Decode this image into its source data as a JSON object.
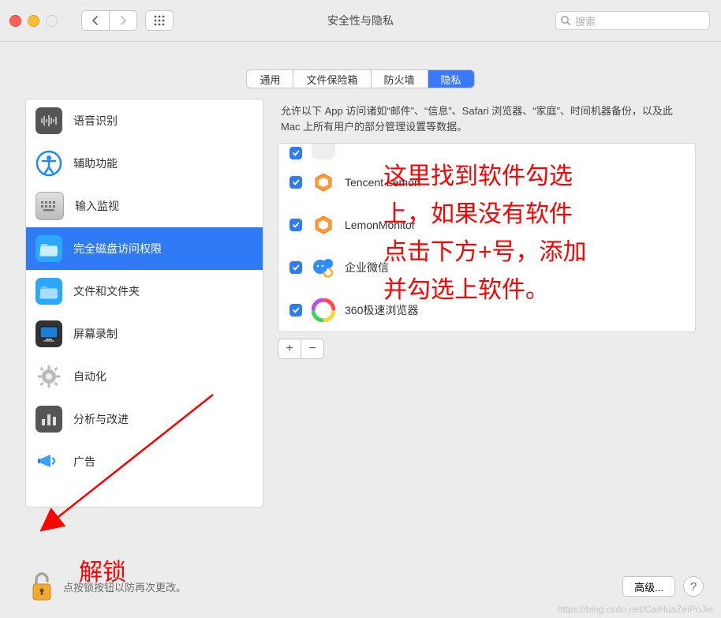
{
  "window": {
    "title": "安全性与隐私",
    "search_placeholder": "搜索"
  },
  "tabs": [
    {
      "label": "通用",
      "active": false
    },
    {
      "label": "文件保险箱",
      "active": false
    },
    {
      "label": "防火墙",
      "active": false
    },
    {
      "label": "隐私",
      "active": true
    }
  ],
  "sidebar": {
    "items": [
      {
        "icon": "waveform-icon",
        "label": "语音识别"
      },
      {
        "icon": "accessibility-icon",
        "label": "辅助功能"
      },
      {
        "icon": "keyboard-icon",
        "label": "输入监视"
      },
      {
        "icon": "folder-icon",
        "label": "完全磁盘访问权限",
        "selected": true
      },
      {
        "icon": "folder-icon",
        "label": "文件和文件夹"
      },
      {
        "icon": "monitor-icon",
        "label": "屏幕录制"
      },
      {
        "icon": "gear-icon",
        "label": "自动化"
      },
      {
        "icon": "barchart-icon",
        "label": "分析与改进"
      },
      {
        "icon": "megaphone-icon",
        "label": "广告"
      }
    ]
  },
  "detail": {
    "description": "允许以下 App 访问诸如“邮件”、“信息”、Safari 浏览器、“家庭”、时间机器备份，以及此 Mac 上所有用户的部分管理设置等数据。",
    "apps": [
      {
        "checked": true,
        "icon": "hexagon-orange",
        "label": "Tencent Lemon"
      },
      {
        "checked": true,
        "icon": "hexagon-orange",
        "label": "LemonMonitor"
      },
      {
        "checked": true,
        "icon": "wecom",
        "label": "企业微信"
      },
      {
        "checked": true,
        "icon": "rainbow",
        "label": "360极速浏览器"
      }
    ],
    "plus_label": "+",
    "minus_label": "−"
  },
  "footer": {
    "lock_text": "点按锁按钮以防再次更改。",
    "advanced_label": "高级...",
    "help_label": "?"
  },
  "annotations": {
    "main": "这里找到软件勾选\n上，如果没有软件\n点击下方+号，添加\n并勾选上软件。",
    "unlock": "解锁"
  },
  "watermark": "https://blog.csdn.net/CaiHuaZeiPoJie"
}
